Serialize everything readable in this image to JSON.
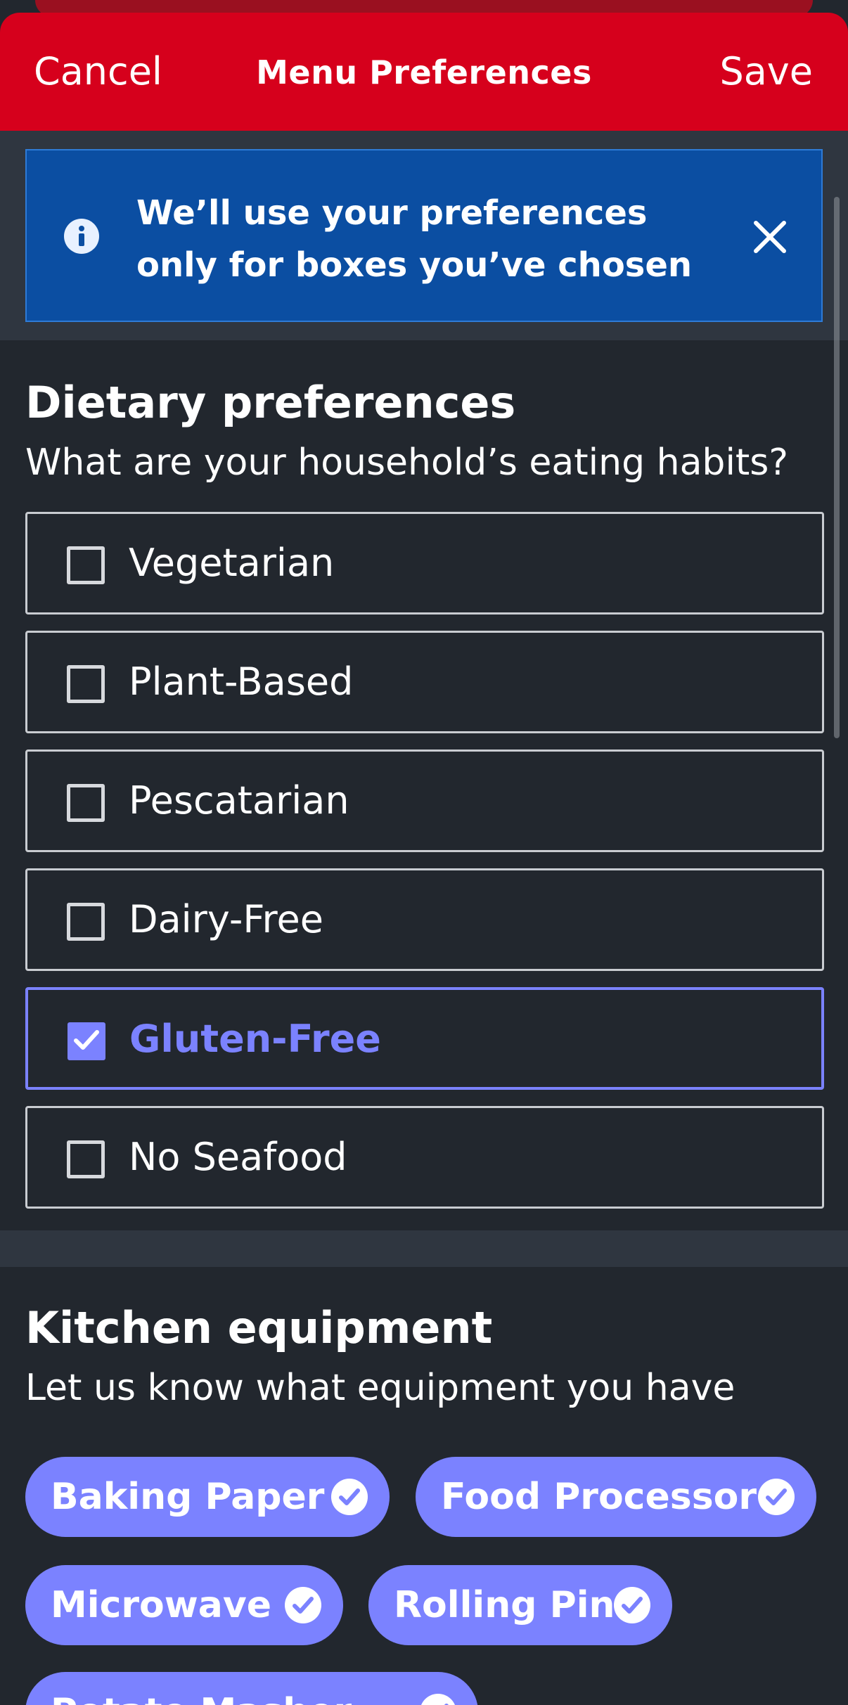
{
  "header": {
    "cancel_label": "Cancel",
    "title": "Menu Preferences",
    "save_label": "Save"
  },
  "banner": {
    "line1": "We’ll use your preferences",
    "line2": "only for boxes you’ve chosen",
    "icon": "info-icon",
    "close_icon": "close-icon"
  },
  "dietary": {
    "title": "Dietary preferences",
    "subtitle": "What are your household’s eating habits?",
    "options": [
      {
        "label": "Vegetarian",
        "checked": false
      },
      {
        "label": "Plant-Based",
        "checked": false
      },
      {
        "label": "Pescatarian",
        "checked": false
      },
      {
        "label": "Dairy-Free",
        "checked": false
      },
      {
        "label": "Gluten-Free",
        "checked": true
      },
      {
        "label": "No Seafood",
        "checked": false
      }
    ]
  },
  "kitchen": {
    "title": "Kitchen equipment",
    "subtitle": "Let us know what equipment you have",
    "chips": [
      {
        "label": "Baking Paper",
        "selected": true
      },
      {
        "label": "Food Processor",
        "selected": true
      },
      {
        "label": "Microwave",
        "selected": true
      },
      {
        "label": "Rolling Pin",
        "selected": true
      },
      {
        "label": "Potato Masher",
        "selected": true
      }
    ]
  },
  "colors": {
    "header_red": "#d6001c",
    "banner_blue": "#0b4ea2",
    "accent_purple": "#7b82ff",
    "background": "#22272e"
  }
}
